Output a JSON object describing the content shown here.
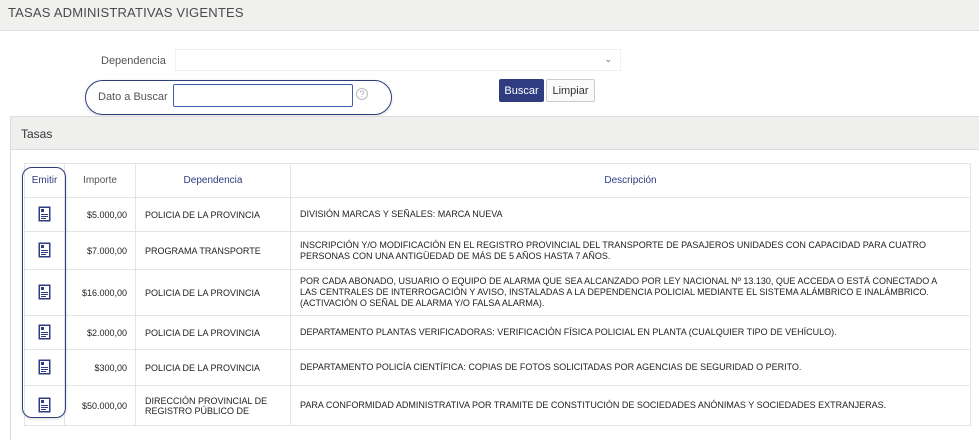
{
  "page": {
    "title": "TASAS ADMINISTRATIVAS VIGENTES"
  },
  "filters": {
    "dependencia_label": "Dependencia",
    "dependencia_value": "",
    "dato_label": "Dato a Buscar",
    "dato_value": "",
    "help": "?",
    "buscar_label": "Buscar",
    "limpiar_label": "Limpiar"
  },
  "panel": {
    "title": "Tasas"
  },
  "table": {
    "headers": {
      "emitir": "Emitir",
      "importe": "Importe",
      "dependencia": "Dependencia",
      "descripcion": "Descripción"
    },
    "rows": [
      {
        "importe": "$5.000,00",
        "dependencia": "POLICIA DE LA PROVINCIA",
        "descripcion": "DIVISIÓN MARCAS Y SEÑALES: MARCA NUEVA"
      },
      {
        "importe": "$7.000,00",
        "dependencia": "PROGRAMA TRANSPORTE",
        "descripcion": "INSCRIPCIÓN Y/O MODIFICACIÓN EN EL REGISTRO PROVINCIAL DEL TRANSPORTE DE PASAJEROS UNIDADES CON CAPACIDAD PARA CUATRO PERSONAS CON UNA ANTIGÜEDAD DE MÁS DE 5 AÑOS HASTA 7 AÑOS."
      },
      {
        "importe": "$16.000,00",
        "dependencia": "POLICIA DE LA PROVINCIA",
        "descripcion": "POR CADA ABONADO, USUARIO O EQUIPO DE ALARMA QUE SEA ALCANZADO POR LEY NACIONAL Nº 13.130, QUE ACCEDA O ESTÁ CONECTADO A LAS CENTRALES DE INTERROGACIÓN Y AVISO, INSTALADAS A LA DEPENDENCIA POLICIAL MEDIANTE EL SISTEMA ALÁMBRICO E INALÁMBRICO. (ACTIVACIÓN O SEÑAL DE ALARMA Y/O FALSA ALARMA)."
      },
      {
        "importe": "$2.000,00",
        "dependencia": "POLICIA DE LA PROVINCIA",
        "descripcion": "DEPARTAMENTO PLANTAS VERIFICADORAS: VERIFICACIÓN FÍSICA POLICIAL EN PLANTA (CUALQUIER TIPO DE VEHÍCULO)."
      },
      {
        "importe": "$300,00",
        "dependencia": "POLICIA DE LA PROVINCIA",
        "descripcion": "DEPARTAMENTO POLICÍA CIENTÍFICA:    COPIAS DE FOTOS SOLICITADAS POR AGENCIAS DE SEGURIDAD O PERITO."
      },
      {
        "importe": "$50.000,00",
        "dependencia": "DIRECCIÓN PROVINCIAL DE REGISTRO PÚBLICO DE",
        "descripcion": "PARA CONFORMIDAD ADMINISTRATIVA POR TRAMITE DE CONSTITUCIÓN DE SOCIEDADES ANÓNIMAS Y SOCIEDADES EXTRANJERAS."
      }
    ]
  },
  "icons": {
    "emitir_icon": "document-icon"
  },
  "colors": {
    "primary": "#2f3c80",
    "header_bg": "#f0f0ef",
    "highlight": "#2c3e7b"
  }
}
